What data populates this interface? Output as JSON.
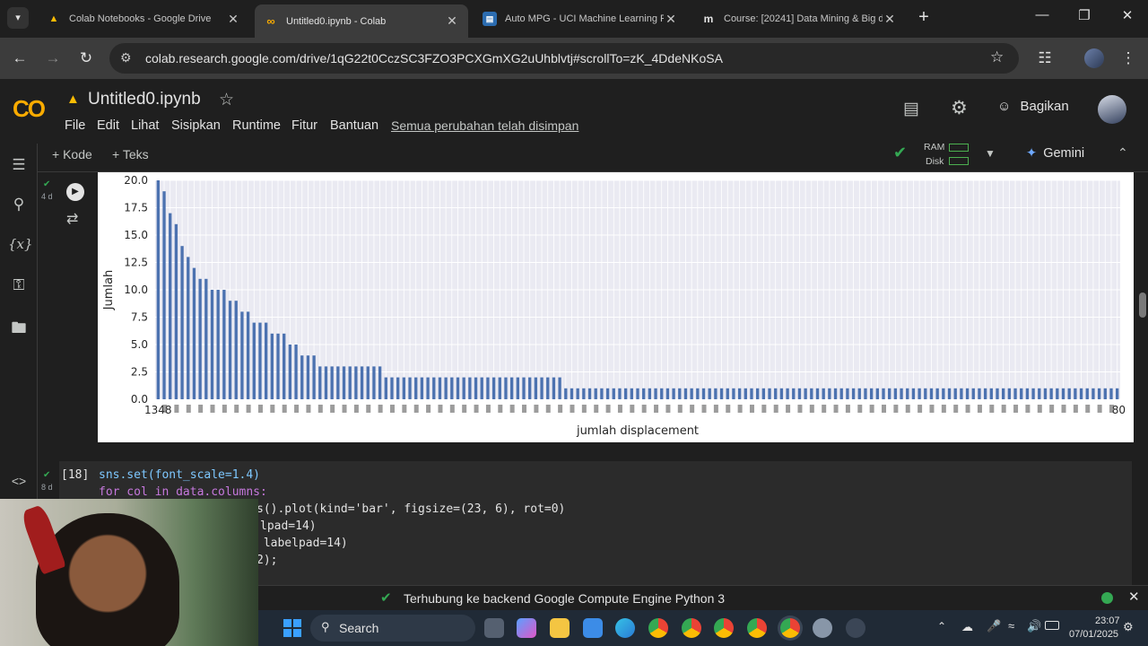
{
  "browser": {
    "tabs": [
      {
        "title": "Colab Notebooks - Google Drive",
        "active": false,
        "favicon": "drive-icon"
      },
      {
        "title": "Untitled0.ipynb - Colab",
        "active": true,
        "favicon": "colab-icon"
      },
      {
        "title": "Auto MPG - UCI Machine Learning Re",
        "active": false,
        "favicon": "uci-icon"
      },
      {
        "title": "Course: [20241] Data Mining & Big da",
        "active": false,
        "favicon": "moodle-icon"
      }
    ],
    "url": "colab.research.google.com/drive/1qG22t0CczSC3FZO3PCXGmXG2uUhblvtj#scrollTo=zK_4DdeNKoSA"
  },
  "colab": {
    "notebook_title": "Untitled0.ipynb",
    "menu": [
      "File",
      "Edit",
      "Lihat",
      "Sisipkan",
      "Runtime",
      "Fitur",
      "Bantuan"
    ],
    "saved_status": "Semua perubahan telah disimpan",
    "share_label": "Bagikan",
    "add_code_label": "+ Kode",
    "add_text_label": "+ Teks",
    "ram_label": "RAM",
    "disk_label": "Disk",
    "gemini_label": "Gemini"
  },
  "cells": {
    "prev_cell_time": "4 d",
    "code_cell_index": "[18]",
    "code_cell_time": "8 d",
    "code_lines": [
      "sns.set(font_scale=1.4)",
      "for col in data.columns:",
      "s().plot(kind='bar', figsize=(23, 6), rot=0)",
      "lpad=14)",
      " labelpad=14)",
      "2);"
    ]
  },
  "status_bar": {
    "message": "Terhubung ke backend Google Compute Engine Python 3",
    "color_connected": "#34a853"
  },
  "taskbar": {
    "search_label": "Search",
    "time": "23:07",
    "date": "07/01/2025"
  },
  "chart_data": {
    "type": "bar",
    "xlabel": "jumlah displacement",
    "ylabel": "Jumlah",
    "ylim": [
      0,
      20
    ],
    "yticks": [
      "0.0",
      "2.5",
      "5.0",
      "7.5",
      "10.0",
      "12.5",
      "15.0",
      "17.5",
      "20.0"
    ],
    "grid": true,
    "color": "#4c72b0",
    "first_tick_label": "1348",
    "last_tick_label": "80",
    "values": [
      20,
      19,
      17,
      16,
      14,
      13,
      12,
      11,
      11,
      10,
      10,
      10,
      9,
      9,
      8,
      8,
      7,
      7,
      7,
      6,
      6,
      6,
      5,
      5,
      4,
      4,
      4,
      3,
      3,
      3,
      3,
      3,
      3,
      3,
      3,
      3,
      3,
      3,
      2,
      2,
      2,
      2,
      2,
      2,
      2,
      2,
      2,
      2,
      2,
      2,
      2,
      2,
      2,
      2,
      2,
      2,
      2,
      2,
      2,
      2,
      2,
      2,
      2,
      2,
      2,
      2,
      2,
      2,
      1,
      1,
      1,
      1,
      1,
      1,
      1,
      1,
      1,
      1,
      1,
      1,
      1,
      1,
      1,
      1,
      1,
      1,
      1,
      1,
      1,
      1,
      1,
      1,
      1,
      1,
      1,
      1,
      1,
      1,
      1,
      1,
      1,
      1,
      1,
      1,
      1,
      1,
      1,
      1,
      1,
      1,
      1,
      1,
      1,
      1,
      1,
      1,
      1,
      1,
      1,
      1,
      1,
      1,
      1,
      1,
      1,
      1,
      1,
      1,
      1,
      1,
      1,
      1,
      1,
      1,
      1,
      1,
      1,
      1,
      1,
      1,
      1,
      1,
      1,
      1,
      1,
      1,
      1,
      1,
      1,
      1,
      1,
      1,
      1,
      1,
      1,
      1,
      1,
      1,
      1,
      1,
      1
    ]
  }
}
